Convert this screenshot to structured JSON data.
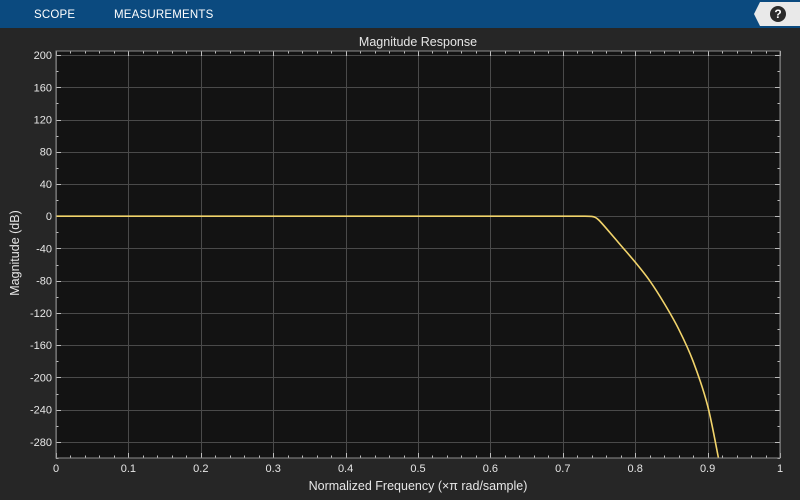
{
  "toolbar": {
    "tabs": [
      {
        "label": "SCOPE"
      },
      {
        "label": "MEASUREMENTS"
      }
    ],
    "help_label": "?"
  },
  "colors": {
    "toolbar_bg": "#0b4a7f",
    "figure_bg": "#262626",
    "axes_bg": "#131313",
    "grid": "#4a4a4a",
    "line": "#f2d46b"
  },
  "chart_data": {
    "type": "line",
    "title": "Magnitude Response",
    "xlabel": "Normalized Frequency (×π rad/sample)",
    "ylabel": "Magnitude (dB)",
    "xlim": [
      0,
      1
    ],
    "ylim": [
      -300,
      205
    ],
    "xticks": [
      0,
      0.1,
      0.2,
      0.3,
      0.4,
      0.5,
      0.6,
      0.7,
      0.8,
      0.9,
      1
    ],
    "xtick_labels": [
      "0",
      "0.1",
      "0.2",
      "0.3",
      "0.4",
      "0.5",
      "0.6",
      "0.7",
      "0.8",
      "0.9",
      "1"
    ],
    "yticks": [
      200,
      160,
      120,
      80,
      40,
      0,
      -40,
      -80,
      -120,
      -160,
      -200,
      -240,
      -280
    ],
    "ytick_labels": [
      "200",
      "160",
      "120",
      "80",
      "40",
      "0",
      "-40",
      "-80",
      "-120",
      "-160",
      "-200",
      "-240",
      "-280"
    ],
    "grid": true,
    "series": [
      {
        "x": [
          0,
          0.1,
          0.2,
          0.3,
          0.4,
          0.5,
          0.6,
          0.7,
          0.73,
          0.74,
          0.745,
          0.75,
          0.76,
          0.78,
          0.8,
          0.82,
          0.84,
          0.86,
          0.88,
          0.9,
          0.915
        ],
        "y": [
          0,
          0,
          0,
          0,
          0,
          0,
          0,
          0,
          0,
          -0.3,
          -1.5,
          -5,
          -15,
          -36,
          -57,
          -80,
          -108,
          -140,
          -180,
          -235,
          -300
        ]
      }
    ]
  }
}
